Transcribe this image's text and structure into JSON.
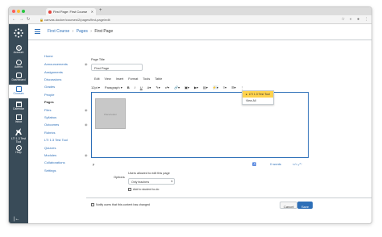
{
  "browser": {
    "tab_title": "First Page: First Course",
    "url": "canvas.docker/courses/2/pages/first-page/edit",
    "colors": {
      "close": "#ff5f57",
      "min": "#febc2e",
      "max": "#28c840"
    }
  },
  "global_nav": {
    "items": [
      {
        "label": "Account"
      },
      {
        "label": "Admin"
      },
      {
        "label": "Dashboard"
      },
      {
        "label": "Courses"
      },
      {
        "label": "Calendar"
      },
      {
        "label": "Inbox"
      },
      {
        "label": "LTI 1.3 Test Tool"
      },
      {
        "label": "Help"
      }
    ]
  },
  "breadcrumb": {
    "course": "First Course",
    "section": "Pages",
    "current": "First Page"
  },
  "course_nav": [
    {
      "label": "Home"
    },
    {
      "label": "Announcements"
    },
    {
      "label": "Assignments"
    },
    {
      "label": "Discussions"
    },
    {
      "label": "Grades"
    },
    {
      "label": "People"
    },
    {
      "label": "Pages"
    },
    {
      "label": "Files"
    },
    {
      "label": "Syllabus"
    },
    {
      "label": "Outcomes"
    },
    {
      "label": "Rubrics"
    },
    {
      "label": "LTI 1.3 Test Tool"
    },
    {
      "label": "Quizzes"
    },
    {
      "label": "Modules"
    },
    {
      "label": "Collaborations"
    },
    {
      "label": "Settings"
    }
  ],
  "editor": {
    "title_label": "Page Title",
    "title_value": "First Page",
    "menus": [
      "Edit",
      "View",
      "Insert",
      "Format",
      "Tools",
      "Table"
    ],
    "font_size": "12pt",
    "block_format": "Paragraph",
    "placeholder_text": "Placeholder",
    "status_element": "p",
    "word_count": "0 words",
    "dropdown_items": [
      "LTI 1.3 Test Tool",
      "View All"
    ]
  },
  "options": {
    "label": "Options",
    "edit_desc": "Users allowed to edit this page",
    "edit_select": "Only teachers",
    "add_student_todo": "Add to student to-do"
  },
  "footer": {
    "notify": "Notify users that this content has changed",
    "cancel": "Cancel",
    "save": "Save"
  }
}
